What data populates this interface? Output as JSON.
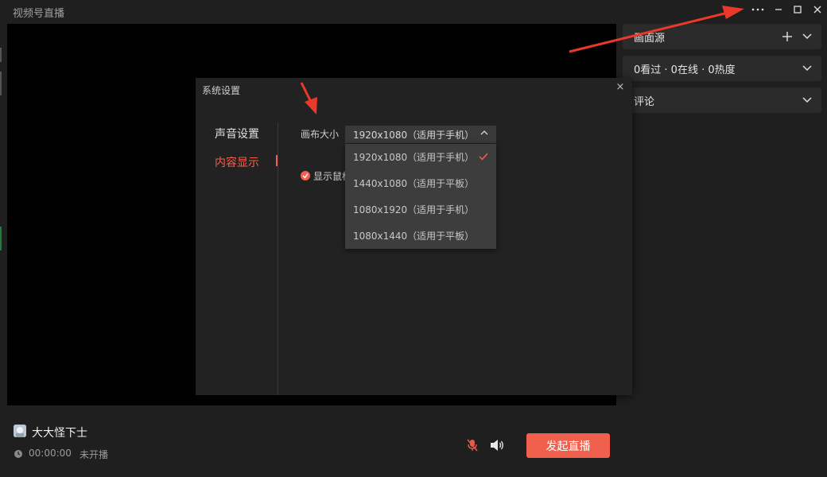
{
  "app": {
    "title": "视频号直播"
  },
  "window_controls": {
    "more": "···",
    "minimize": "—",
    "maximize": "□",
    "close": "✕"
  },
  "side": {
    "source_label": "画面源",
    "stats_label": "0看过 · 0在线 · 0热度",
    "comments_label": "评论"
  },
  "bottom": {
    "username": "大大怪下士",
    "timer": "00:00:00",
    "status": "未开播",
    "start_button": "发起直播"
  },
  "dialog": {
    "title": "系统设置",
    "close": "×",
    "nav": [
      "声音设置",
      "内容显示"
    ],
    "canvas_label": "画布大小",
    "selected_value": "1920x1080（适用于手机）",
    "checkbox_label": "显示鼠标",
    "options": [
      "1920x1080（适用于手机）",
      "1440x1080（适用于平板）",
      "1080x1920（适用于手机）",
      "1080x1440（适用于平板）"
    ]
  },
  "colors": {
    "accent": "#f0604d",
    "background": "#1f1f1f",
    "panel": "#2b2b2b",
    "arrow": "#e8392b"
  }
}
